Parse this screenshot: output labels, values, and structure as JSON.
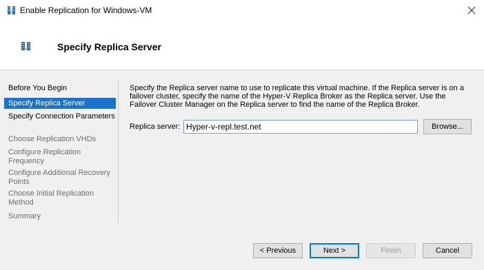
{
  "window": {
    "title": "Enable Replication for Windows-VM",
    "close_icon": "close-icon"
  },
  "header": {
    "title": "Specify Replica Server",
    "icon": "replication-server-icon"
  },
  "nav": {
    "items": [
      {
        "label": "Before You Begin",
        "state": "normal"
      },
      {
        "label": "Specify Replica Server",
        "state": "active"
      },
      {
        "label": "Specify Connection Parameters",
        "state": "normal"
      },
      {
        "label": "Choose Replication VHDs",
        "state": "disabled"
      },
      {
        "label": "Configure Replication Frequency",
        "state": "disabled"
      },
      {
        "label": "Configure Additional Recovery Points",
        "state": "disabled"
      },
      {
        "label": "Choose Initial Replication Method",
        "state": "disabled"
      },
      {
        "label": "Summary",
        "state": "disabled"
      }
    ]
  },
  "content": {
    "description": "Specify the Replica server name to use to replicate this virtual machine. If the Replica server is on a failover cluster, specify the name of the Hyper-V Replica Broker as the Replica server. Use the Failover Cluster Manager on the Replica server to find the name of the Replica Broker.",
    "replica_label": "Replica server:",
    "replica_value": "Hyper-v-repl.test.net",
    "browse_label": "Browse..."
  },
  "footer": {
    "previous_label": "< Previous",
    "next_label": "Next >",
    "finish_label": "Finish",
    "cancel_label": "Cancel"
  },
  "colors": {
    "accent": "#1a73c9",
    "panel": "#f0f0f0",
    "disabled_text": "#6d6d6d"
  }
}
